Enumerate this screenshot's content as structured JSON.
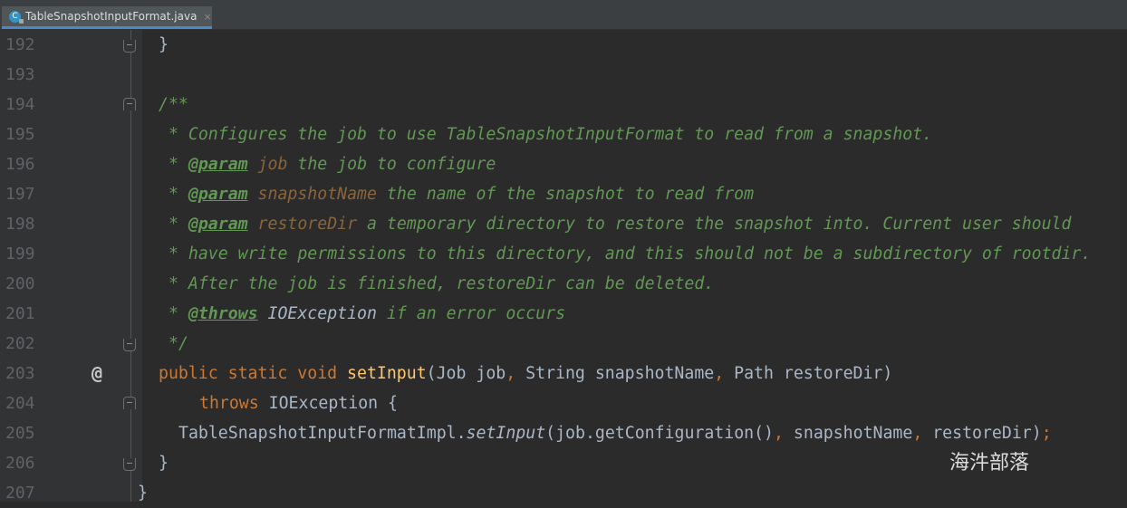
{
  "tab": {
    "filename": "TableSnapshotInputFormat.java",
    "close_glyph": "×",
    "icon": "java-class-icon"
  },
  "lines": [
    {
      "num": "192"
    },
    {
      "num": "193"
    },
    {
      "num": "194"
    },
    {
      "num": "195"
    },
    {
      "num": "196"
    },
    {
      "num": "197"
    },
    {
      "num": "198"
    },
    {
      "num": "199"
    },
    {
      "num": "200"
    },
    {
      "num": "201"
    },
    {
      "num": "202"
    },
    {
      "num": "203"
    },
    {
      "num": "204"
    },
    {
      "num": "205"
    },
    {
      "num": "206"
    },
    {
      "num": "207"
    }
  ],
  "code": {
    "l192": "}",
    "l194": "/**",
    "l195": "* Configures the job to use TableSnapshotInputFormat to read from a snapshot.",
    "l196_star": "* ",
    "l196_tag": "@param",
    "l196_name": " job",
    "l196_text": " the job to configure",
    "l197_star": "* ",
    "l197_tag": "@param",
    "l197_name": " snapshotName",
    "l197_text": " the name of the snapshot to read from",
    "l198_star": "* ",
    "l198_tag": "@param",
    "l198_name": " restoreDir",
    "l198_text": " a temporary directory to restore the snapshot into. Current user should",
    "l199": "* have write permissions to this directory, and this should not be a subdirectory of rootdir.",
    "l200": "* After the job is finished, restoreDir can be deleted.",
    "l201_star": "* ",
    "l201_tag": "@throws",
    "l201_name": " IOException",
    "l201_text": " if an error occurs",
    "l202": "*/",
    "l203_kw": "public static void ",
    "l203_fn": "setInput",
    "l203_open": "(Job job",
    "l203_c1": ", ",
    "l203_p2": "String snapshotName",
    "l203_c2": ", ",
    "l203_p3": "Path restoreDir)",
    "l204_kw": "throws ",
    "l204_rest": "IOException {",
    "l205_cls": "TableSnapshotInputFormatImpl.",
    "l205_fn": "setInput",
    "l205_a1": "(job.getConfiguration()",
    "l205_c1": ", ",
    "l205_a2": "snapshotName",
    "l205_c2": ", ",
    "l205_a3": "restoreDir)",
    "l205_end": ";",
    "l206": "}",
    "l207": "}"
  },
  "gutter_marker": "@",
  "watermark": "海汼部落",
  "colors": {
    "background": "#2b2b2b",
    "gutter": "#313335",
    "keyword": "#cc7832",
    "method": "#ffc66d",
    "doc_comment": "#629755",
    "param_name": "#8a653b",
    "text": "#a9b7c6",
    "line_number": "#606366"
  }
}
